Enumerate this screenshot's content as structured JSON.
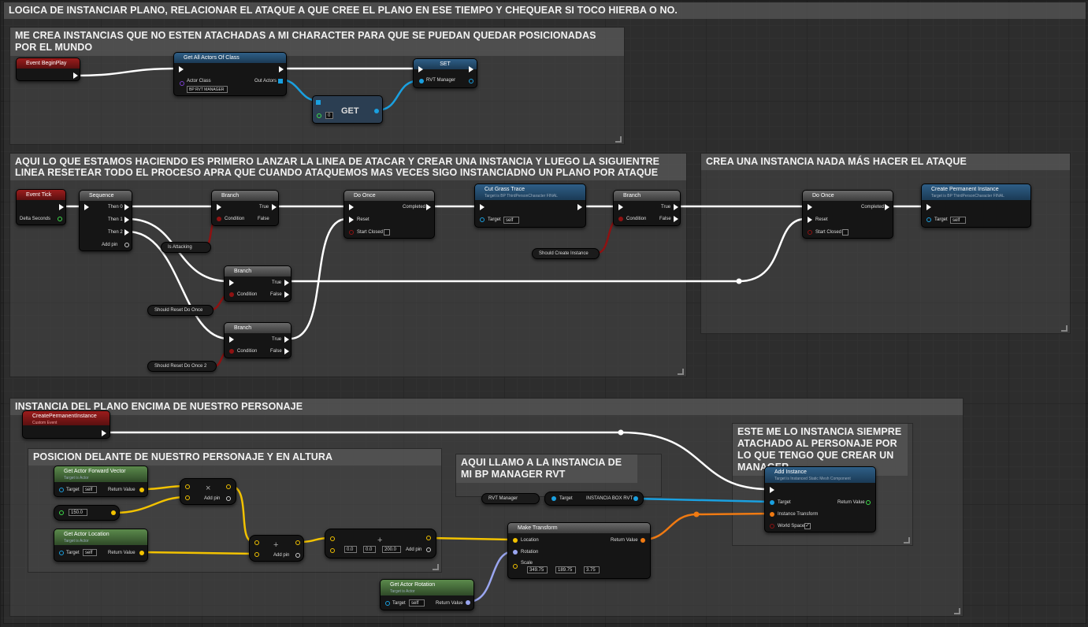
{
  "main_comment": {
    "title": "LOGICA DE INSTANCIAR PLANO, RELACIONAR EL ATAQUE A QUE CREE EL PLANO EN ESE TIEMPO Y CHEQUEAR SI TOCO HIERBA O NO."
  },
  "comment_1": {
    "title": "ME CREA INSTANCIAS QUE NO ESTEN ATACHADAS A MI CHARACTER PARA QUE SE PUEDAN QUEDAR POSICIONADAS POR EL MUNDO"
  },
  "comment_2": {
    "title": "AQUI LO QUE ESTAMOS HACIENDO ES PRIMERO LANZAR LA LINEA DE ATACAR Y CREAR UNA INSTANCIA Y LUEGO LA SIGUIENTRE LINEA RESETEAR TODO EL PROCESO APRA QUE CUANDO ATAQUEMOS MAS VECES SIGO INSTANCIADNO UN PLANO POR ATAQUE"
  },
  "comment_3": {
    "title": "CREA UNA INSTANCIA NADA MÁS HACER EL ATAQUE"
  },
  "comment_4": {
    "title": "INSTANCIA DEL PLANO ENCIMA DE NUESTRO PERSONAJE"
  },
  "comment_5": {
    "title": "POSICION DELANTE DE NUESTRO PERSONAJE Y EN ALTURA"
  },
  "comment_6": {
    "title": "AQUI LLAMO A LA INSTANCIA DE MI BP MANAGER RVT"
  },
  "comment_7": {
    "title": "ESTE ME LO INSTANCIA SIEMPRE ATACHADO AL PERSONAJE POR LO QUE TENGO QUE CREAR UN MANAGER"
  },
  "nodes": {
    "begin_play": {
      "title": "Event BeginPlay"
    },
    "get_all_actors": {
      "title": "Get All Actors Of Class",
      "actor_class": "Actor Class",
      "class_value": "BP RVT MANAGER",
      "out_actors": "Out Actors"
    },
    "get": {
      "title": "GET",
      "index": "0"
    },
    "set": {
      "title": "SET",
      "var": "RVT Manager"
    },
    "event_tick": {
      "title": "Event Tick",
      "delta": "Delta Seconds"
    },
    "sequence": {
      "title": "Sequence",
      "then0": "Then 0",
      "then1": "Then 1",
      "then2": "Then 2",
      "add_pin": "Add pin"
    },
    "branch_label": "Branch",
    "true_label": "True",
    "false_label": "False",
    "condition_label": "Condition",
    "do_once": {
      "title": "Do Once",
      "completed": "Completed",
      "reset": "Reset",
      "start_closed": "Start Closed"
    },
    "cut_grass": {
      "title": "Cut Grass Trace",
      "sub": "Target is BP ThirdPersonCharacter FINAL",
      "target": "Target",
      "self": "self"
    },
    "create_perm": {
      "title": "Create Permanent Instance",
      "sub": "Target is BP ThirdPersonCharacter FINAL",
      "target": "Target",
      "self": "self"
    },
    "is_attacking": "Is Attacking",
    "should_reset": "Should Reset Do Once",
    "should_reset2": "Should Reset Do Once 2",
    "should_create": "Should Create Instance",
    "custom_event": {
      "title": "CreatePermanentInstance",
      "sub": "Custom Event"
    },
    "fwd_vector": {
      "title": "Get Actor Forward Vector",
      "sub": "Target is Actor",
      "target": "Target",
      "self": "self",
      "ret": "Return Value"
    },
    "float_val": "150.0",
    "get_loc": {
      "title": "Get Actor Location",
      "sub": "Target is Actor",
      "target": "Target",
      "self": "self",
      "ret": "Return Value"
    },
    "get_rot": {
      "title": "Get Actor Rotation",
      "sub": "Target is Actor",
      "target": "Target",
      "self": "self",
      "ret": "Return Value"
    },
    "multiply": {
      "symbol": "×",
      "add_pin": "Add pin"
    },
    "add1": {
      "symbol": "+",
      "add_pin": "Add pin"
    },
    "add2": {
      "symbol": "+",
      "add_pin": "Add pin",
      "x": "0.0",
      "y": "0.0",
      "z": "200.0"
    },
    "make_transform": {
      "title": "Make Transform",
      "location": "Location",
      "rotation": "Rotation",
      "scale": "Scale",
      "ret": "Return Value",
      "sx": "349.75",
      "sy": "189.75",
      "sz": "3.75"
    },
    "rvt_manager_var": "RVT Manager",
    "instancia_box": {
      "target": "Target",
      "name": "INSTANCIA BOX RVT"
    },
    "add_instance": {
      "title": "Add Instance",
      "sub": "Target is Instanced Static Mesh Component",
      "target": "Target",
      "transform": "Instance Transform",
      "world_space": "World Space",
      "ret": "Return Value"
    }
  },
  "colors": {
    "exec": "#ffffff",
    "bool": "#8e1212",
    "object": "#1aa0e0",
    "vector": "#f2c200",
    "rotator": "#9aa6f0",
    "transform": "#f07a12",
    "float": "#3ddc4a"
  }
}
